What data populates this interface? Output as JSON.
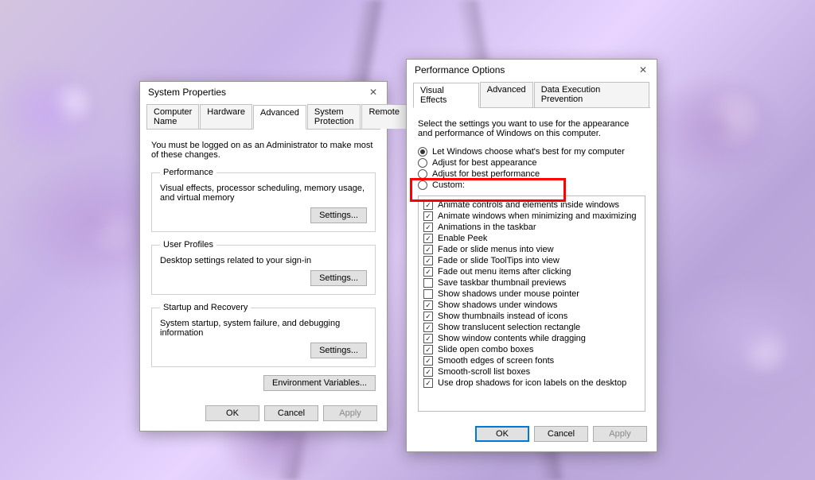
{
  "sysProps": {
    "title": "System Properties",
    "tabs": [
      "Computer Name",
      "Hardware",
      "Advanced",
      "System Protection",
      "Remote"
    ],
    "activeTab": 2,
    "instruction": "You must be logged on as an Administrator to make most of these changes.",
    "groups": [
      {
        "legend": "Performance",
        "desc": "Visual effects, processor scheduling, memory usage, and virtual memory",
        "btn": "Settings..."
      },
      {
        "legend": "User Profiles",
        "desc": "Desktop settings related to your sign-in",
        "btn": "Settings..."
      },
      {
        "legend": "Startup and Recovery",
        "desc": "System startup, system failure, and debugging information",
        "btn": "Settings..."
      }
    ],
    "envBtn": "Environment Variables...",
    "ok": "OK",
    "cancel": "Cancel",
    "apply": "Apply"
  },
  "perfOpts": {
    "title": "Performance Options",
    "tabs": [
      "Visual Effects",
      "Advanced",
      "Data Execution Prevention"
    ],
    "activeTab": 0,
    "instruction": "Select the settings you want to use for the appearance and performance of Windows on this computer.",
    "radios": [
      {
        "label": "Let Windows choose what's best for my computer",
        "checked": true
      },
      {
        "label": "Adjust for best appearance",
        "checked": false
      },
      {
        "label": "Adjust for best performance",
        "checked": false
      },
      {
        "label": "Custom:",
        "checked": false
      }
    ],
    "options": [
      {
        "label": "Animate controls and elements inside windows",
        "checked": true
      },
      {
        "label": "Animate windows when minimizing and maximizing",
        "checked": true
      },
      {
        "label": "Animations in the taskbar",
        "checked": true
      },
      {
        "label": "Enable Peek",
        "checked": true
      },
      {
        "label": "Fade or slide menus into view",
        "checked": true
      },
      {
        "label": "Fade or slide ToolTips into view",
        "checked": true
      },
      {
        "label": "Fade out menu items after clicking",
        "checked": true
      },
      {
        "label": "Save taskbar thumbnail previews",
        "checked": false
      },
      {
        "label": "Show shadows under mouse pointer",
        "checked": false
      },
      {
        "label": "Show shadows under windows",
        "checked": true
      },
      {
        "label": "Show thumbnails instead of icons",
        "checked": true
      },
      {
        "label": "Show translucent selection rectangle",
        "checked": true
      },
      {
        "label": "Show window contents while dragging",
        "checked": true
      },
      {
        "label": "Slide open combo boxes",
        "checked": true
      },
      {
        "label": "Smooth edges of screen fonts",
        "checked": true
      },
      {
        "label": "Smooth-scroll list boxes",
        "checked": true
      },
      {
        "label": "Use drop shadows for icon labels on the desktop",
        "checked": true
      }
    ],
    "ok": "OK",
    "cancel": "Cancel",
    "apply": "Apply"
  }
}
